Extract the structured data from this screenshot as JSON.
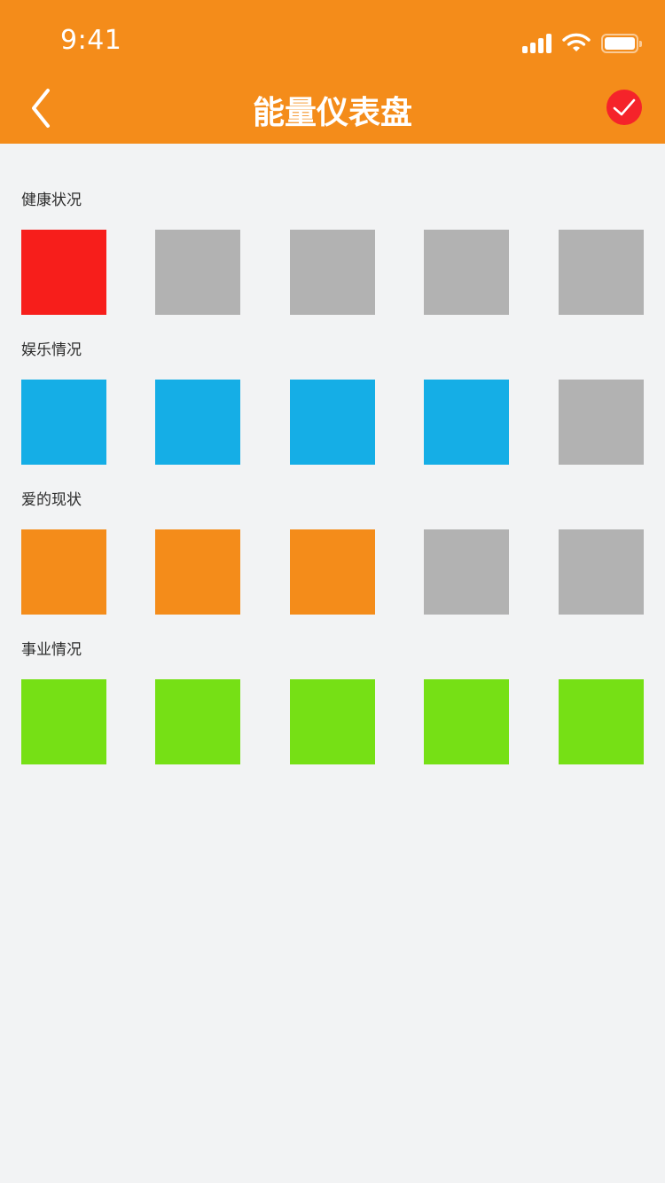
{
  "status_bar": {
    "time": "9:41"
  },
  "nav": {
    "title": "能量仪表盘",
    "back_icon": "chevron-left-icon",
    "confirm_icon": "check-circle-icon",
    "confirm_color": "#f5232a"
  },
  "colors": {
    "header_bg": "#f48c1a",
    "page_bg": "#f2f3f4",
    "inactive_tile": "#b2b2b2"
  },
  "categories": [
    {
      "label": "健康状况",
      "color": "#f71e1b",
      "filled": 1,
      "total": 5
    },
    {
      "label": "娱乐情况",
      "color": "#15aee6",
      "filled": 4,
      "total": 5
    },
    {
      "label": "爱的现状",
      "color": "#f48c1a",
      "filled": 3,
      "total": 5
    },
    {
      "label": "事业情况",
      "color": "#76e015",
      "filled": 5,
      "total": 5
    }
  ]
}
